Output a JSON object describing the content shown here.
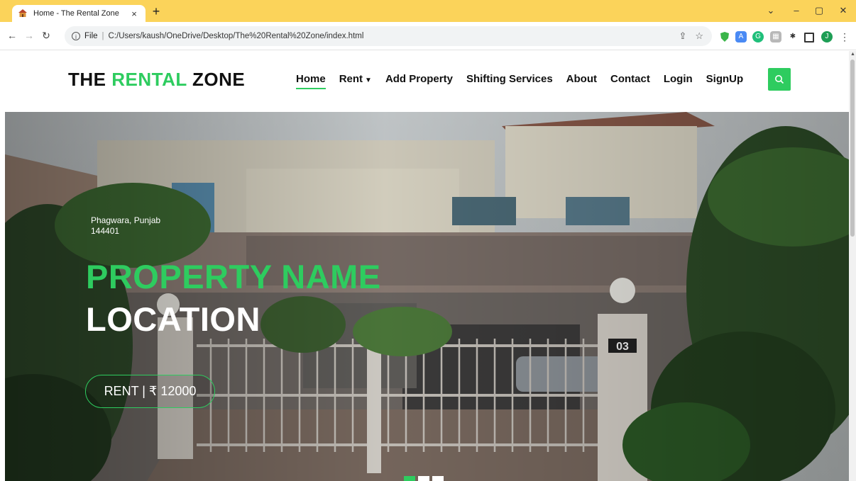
{
  "browser": {
    "tab_title": "Home - The Rental Zone",
    "tab_close": "×",
    "new_tab": "+",
    "file_label": "File",
    "url": "C:/Users/kaush/OneDrive/Desktop/The%20Rental%20Zone/index.html",
    "window_controls": [
      "⌄",
      "–",
      "▢",
      "✕"
    ],
    "profile_initial": "J"
  },
  "site": {
    "logo_part1": "THE",
    "logo_accent": "RENTAL",
    "logo_part2": "ZONE",
    "nav": [
      "Home",
      "Rent",
      "Add Property",
      "Shifting Services",
      "About",
      "Contact",
      "Login",
      "SignUp"
    ],
    "active_nav": "Home",
    "accent_color": "#2ecc5f"
  },
  "hero": {
    "address_line1": "Phagwara, Punjab",
    "address_line2": "144401",
    "property_name": "PROPERTY NAME",
    "location": "LOCATION",
    "rent_button": "RENT | ₹ 12000",
    "house_number": "03",
    "slides": 3,
    "active_slide": 1
  }
}
